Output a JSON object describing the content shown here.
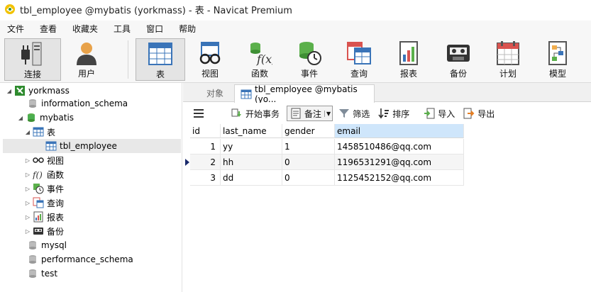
{
  "window": {
    "title": "tbl_employee @mybatis (yorkmass) - 表 - Navicat Premium"
  },
  "menu": [
    "文件",
    "查看",
    "收藏夹",
    "工具",
    "窗口",
    "帮助"
  ],
  "toolbar": {
    "connect": "连接",
    "user": "用户",
    "table": "表",
    "view": "视图",
    "function": "函数",
    "event": "事件",
    "query": "查询",
    "report": "报表",
    "backup": "备份",
    "schedule": "计划",
    "model": "模型"
  },
  "tree": {
    "connection": "yorkmass",
    "db_information_schema": "information_schema",
    "db_mybatis": "mybatis",
    "group_tables": "表",
    "table_employee": "tbl_employee",
    "group_views": "视图",
    "group_functions": "函数",
    "group_events": "事件",
    "group_queries": "查询",
    "group_reports": "报表",
    "group_backups": "备份",
    "db_mysql": "mysql",
    "db_performance_schema": "performance_schema",
    "db_test": "test"
  },
  "tabs": {
    "objects": "对象",
    "active": "tbl_employee @mybatis (yo..."
  },
  "actions": {
    "begin_transaction": "开始事务",
    "memo": "备注",
    "filter": "筛选",
    "sort": "排序",
    "import": "导入",
    "export": "导出"
  },
  "grid": {
    "columns": [
      "id",
      "last_name",
      "gender",
      "email"
    ],
    "rows": [
      [
        "1",
        "yy",
        "1",
        "1458510486@qq.com"
      ],
      [
        "2",
        "hh",
        "0",
        "1196531291@qq.com"
      ],
      [
        "3",
        "dd",
        "0",
        "1125452152@qq.com"
      ]
    ],
    "current_row": 1
  },
  "colors": {
    "selected_header": "#cfe6fb",
    "db_icon_green": "#4caf50",
    "connection_green": "#2e8b2e"
  }
}
